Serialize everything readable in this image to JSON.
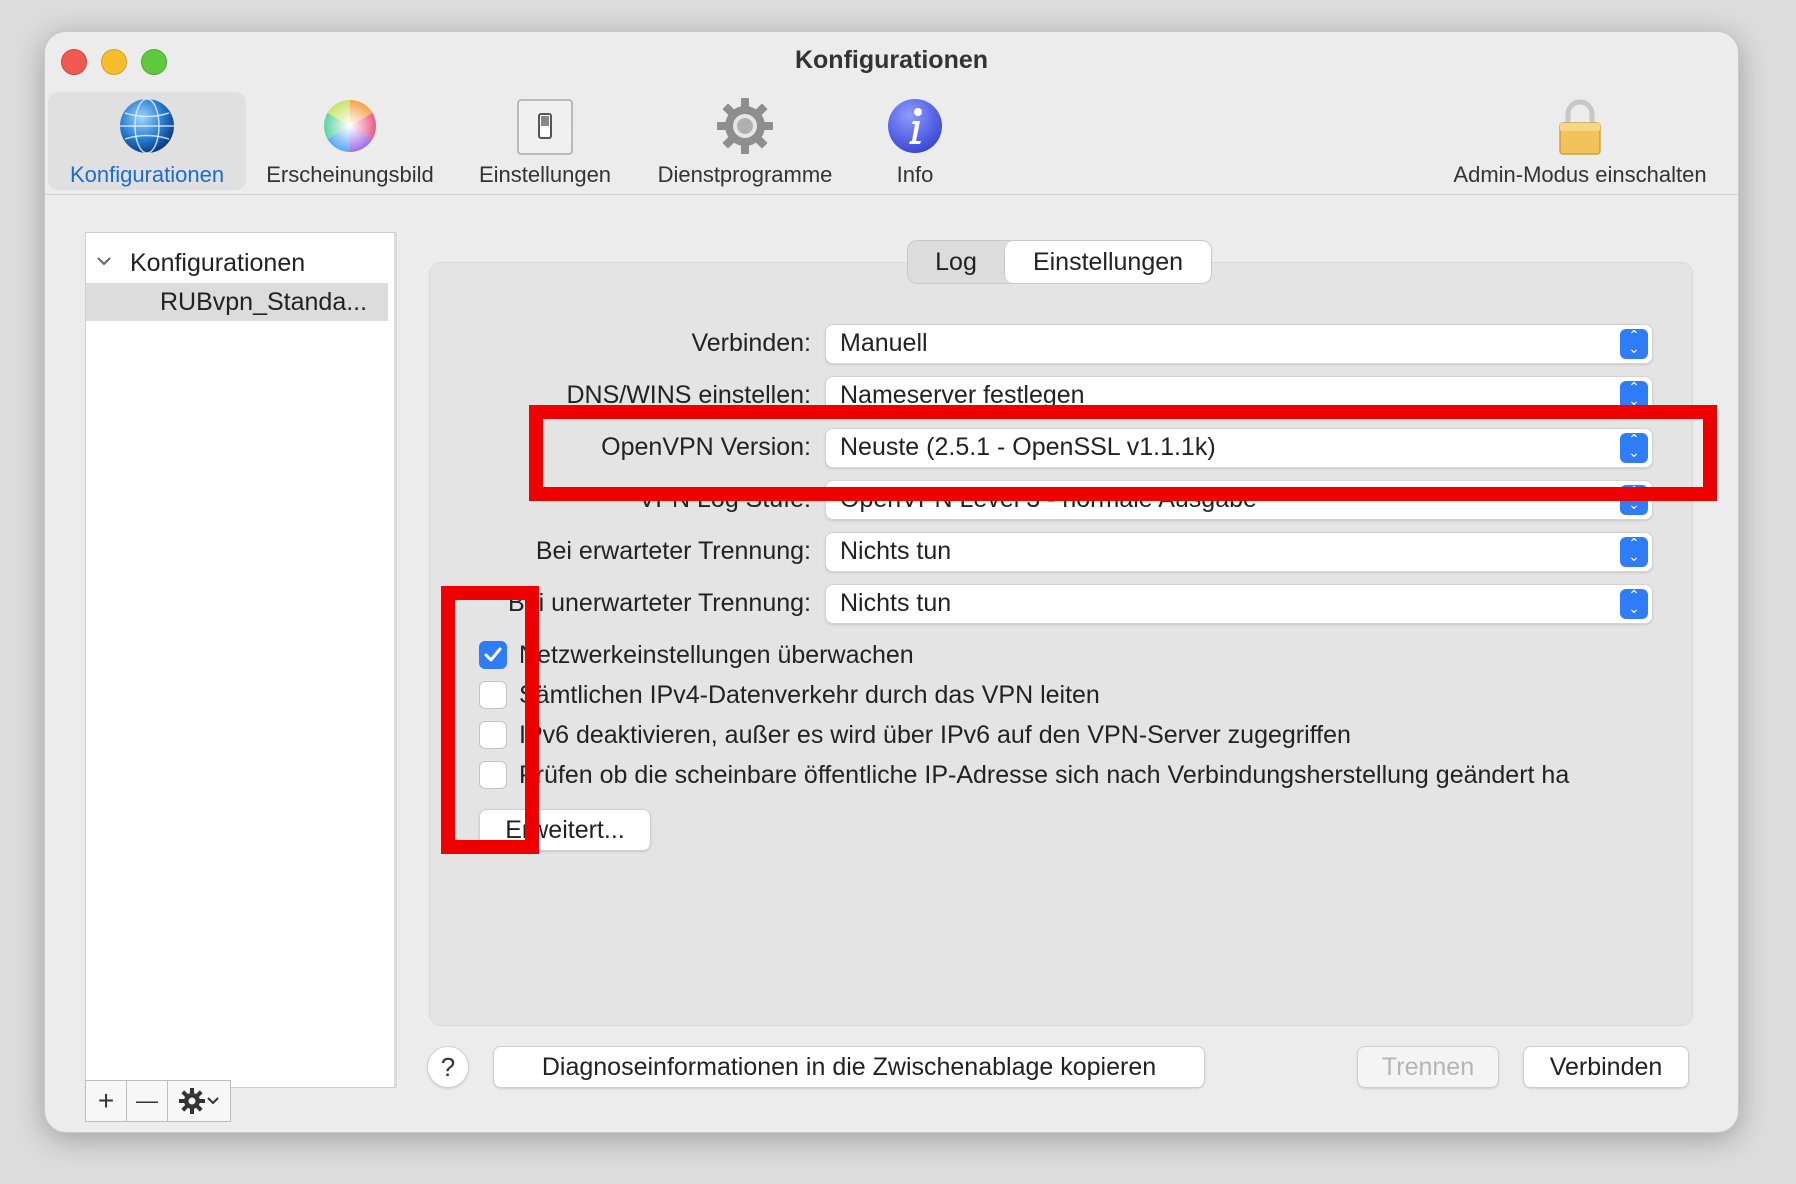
{
  "window": {
    "title": "Konfigurationen"
  },
  "toolbar": {
    "items": [
      {
        "label": "Konfigurationen",
        "icon": "globe-icon",
        "selected": true
      },
      {
        "label": "Erscheinungsbild",
        "icon": "color-wheel-icon"
      },
      {
        "label": "Einstellungen",
        "icon": "switch-icon"
      },
      {
        "label": "Dienstprogramme",
        "icon": "gear-icon"
      },
      {
        "label": "Info",
        "icon": "info-icon"
      }
    ],
    "admin_label": "Admin-Modus einschalten"
  },
  "sidebar": {
    "group": "Konfigurationen",
    "items": [
      {
        "label": "RUBvpn_Standa..."
      }
    ],
    "tools": {
      "add": "+",
      "remove": "—"
    }
  },
  "tabs": {
    "log": "Log",
    "settings": "Einstellungen",
    "active": "Einstellungen"
  },
  "form": {
    "rows": [
      {
        "label": "Verbinden:",
        "value": "Manuell"
      },
      {
        "label": "DNS/WINS einstellen:",
        "value": "Nameserver festlegen"
      },
      {
        "label": "OpenVPN Version:",
        "value": "Neuste (2.5.1 - OpenSSL v1.1.1k)"
      },
      {
        "label": "VPN Log Stufe:",
        "value": "OpenVPN Level 3 - normale Ausgabe"
      },
      {
        "label": "Bei erwarteter Trennung:",
        "value": "Nichts tun"
      },
      {
        "label": "Bei unerwarteter Trennung:",
        "value": "Nichts tun"
      }
    ],
    "checkboxes": [
      {
        "label": "Netzwerkeinstellungen überwachen",
        "checked": true
      },
      {
        "label": "Sämtlichen IPv4-Datenverkehr durch das VPN leiten",
        "checked": false
      },
      {
        "label": "IPv6 deaktivieren, außer es wird über IPv6 auf den VPN-Server zugegriffen",
        "checked": false
      },
      {
        "label": "Prüfen ob die scheinbare öffentliche IP-Adresse sich nach Verbindungsherstellung geändert ha",
        "checked": false
      }
    ],
    "advanced_button": "Erweitert..."
  },
  "footer": {
    "help": "?",
    "copy_diag": "Diagnoseinformationen in die Zwischenablage kopieren",
    "disconnect": "Trennen",
    "connect": "Verbinden"
  },
  "colors": {
    "accent": "#2f7cf6",
    "highlight": "#ef0000",
    "selected_tab_text": "#1b6bd7"
  }
}
